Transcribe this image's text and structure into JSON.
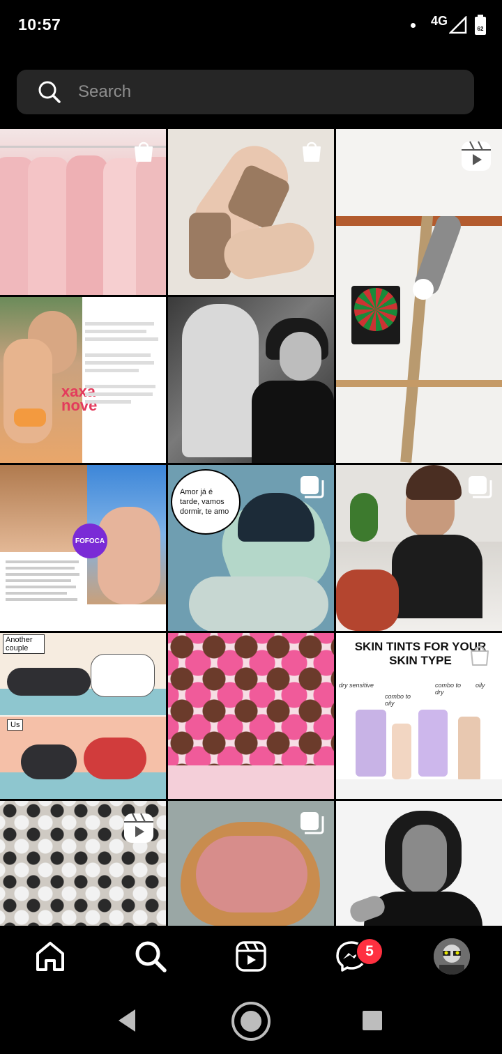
{
  "status_bar": {
    "time": "10:57",
    "network": "4G",
    "battery": "62"
  },
  "search": {
    "placeholder": "Search"
  },
  "grid": {
    "tiles": [
      {
        "badge": "shopping-bag-icon"
      },
      {
        "badge": "shopping-bag-icon"
      },
      {
        "badge": "reels-icon"
      },
      {
        "badge": ""
      },
      {
        "badge": ""
      },
      {
        "badge": ""
      },
      {
        "badge": ""
      },
      {
        "badge": "carousel-icon",
        "speech_bubble": "Amor já é tarde, vamos dormir, te amo"
      },
      {
        "badge": "carousel-icon"
      },
      {
        "badge": "",
        "label_top": "Another couple",
        "label_bottom": "Us"
      },
      {
        "badge": ""
      },
      {
        "badge": "shopping-bag-icon",
        "headline": "SKIN TINTS FOR YOUR SKIN TYPE",
        "labels": [
          "dry sensitive",
          "combo to oily",
          "combo to dry",
          "oily"
        ]
      },
      {
        "badge": "reels-icon"
      },
      {
        "badge": "carousel-icon"
      },
      {
        "badge": ""
      }
    ],
    "news_logo": "FOFOCA",
    "brand_text": "xaxa nove"
  },
  "bottom_nav": {
    "items": [
      "home",
      "search",
      "reels",
      "messenger",
      "profile"
    ],
    "messenger_badge": "5"
  },
  "colors": {
    "background": "#000000",
    "search_bg": "#262626",
    "placeholder": "#8e8e8e",
    "notification": "#ff3040"
  }
}
